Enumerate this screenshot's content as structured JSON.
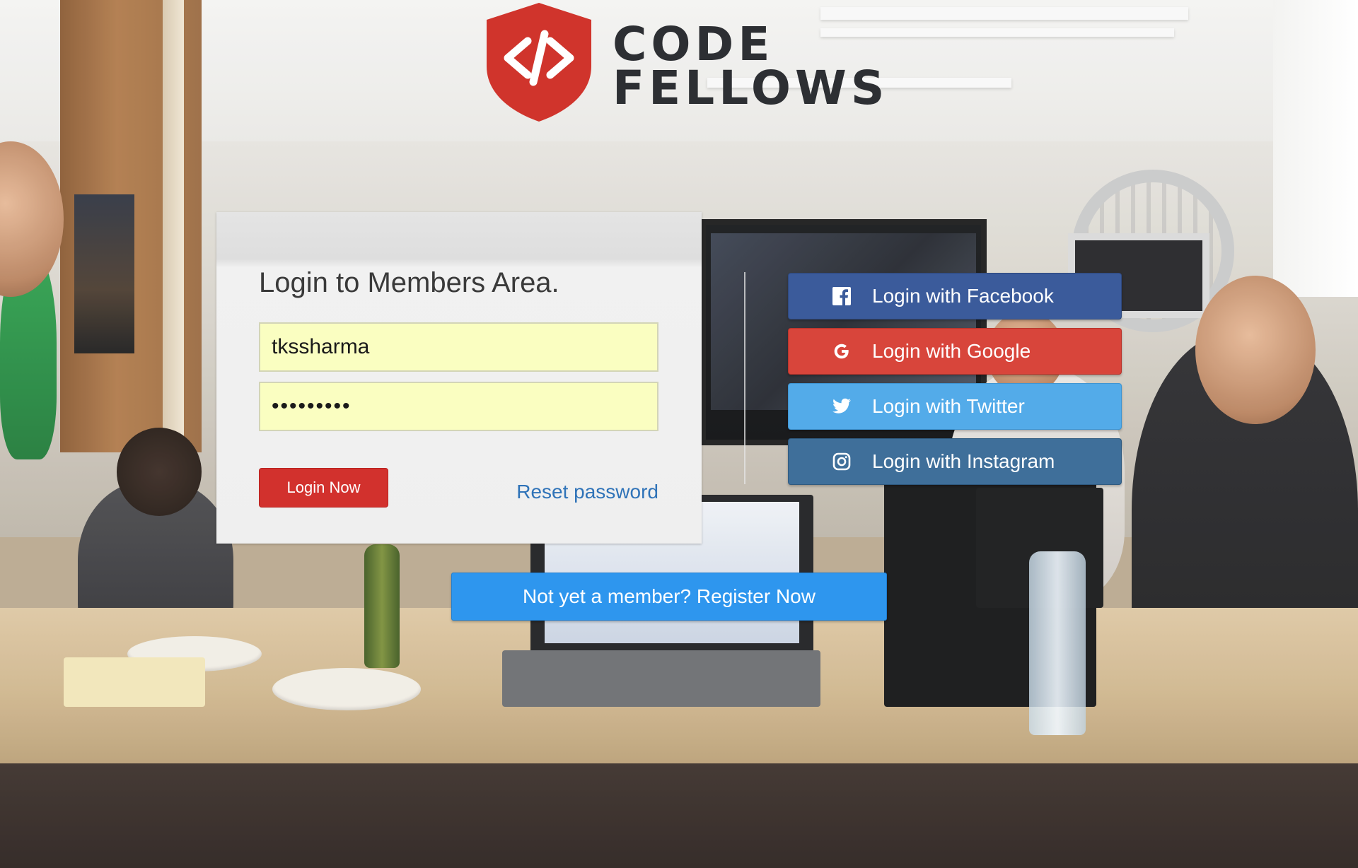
{
  "brand": {
    "line1": "CODE",
    "line2": "FELLOWS",
    "shield_color": "#d0342c",
    "text_color": "#2d2f33"
  },
  "login": {
    "title": "Login to Members Area.",
    "username_value": "tkssharma",
    "password_value": "•••••••••",
    "submit_label": "Login Now",
    "reset_label": "Reset password"
  },
  "social": {
    "facebook": {
      "label": "Login with Facebook",
      "icon": "facebook-icon",
      "color": "#3b5b9b"
    },
    "google": {
      "label": "Login with Google",
      "icon": "google-icon",
      "color": "#d8453b"
    },
    "twitter": {
      "label": "Login with Twitter",
      "icon": "twitter-icon",
      "color": "#53abe9"
    },
    "instagram": {
      "label": "Login with Instagram",
      "icon": "instagram-icon",
      "color": "#3f6f9a"
    }
  },
  "register": {
    "label": "Not yet a member? Register Now",
    "color": "#2e96ee"
  },
  "colors": {
    "login_button": "#d2312d",
    "input_background": "#fafec1",
    "link": "#2f73b8"
  }
}
